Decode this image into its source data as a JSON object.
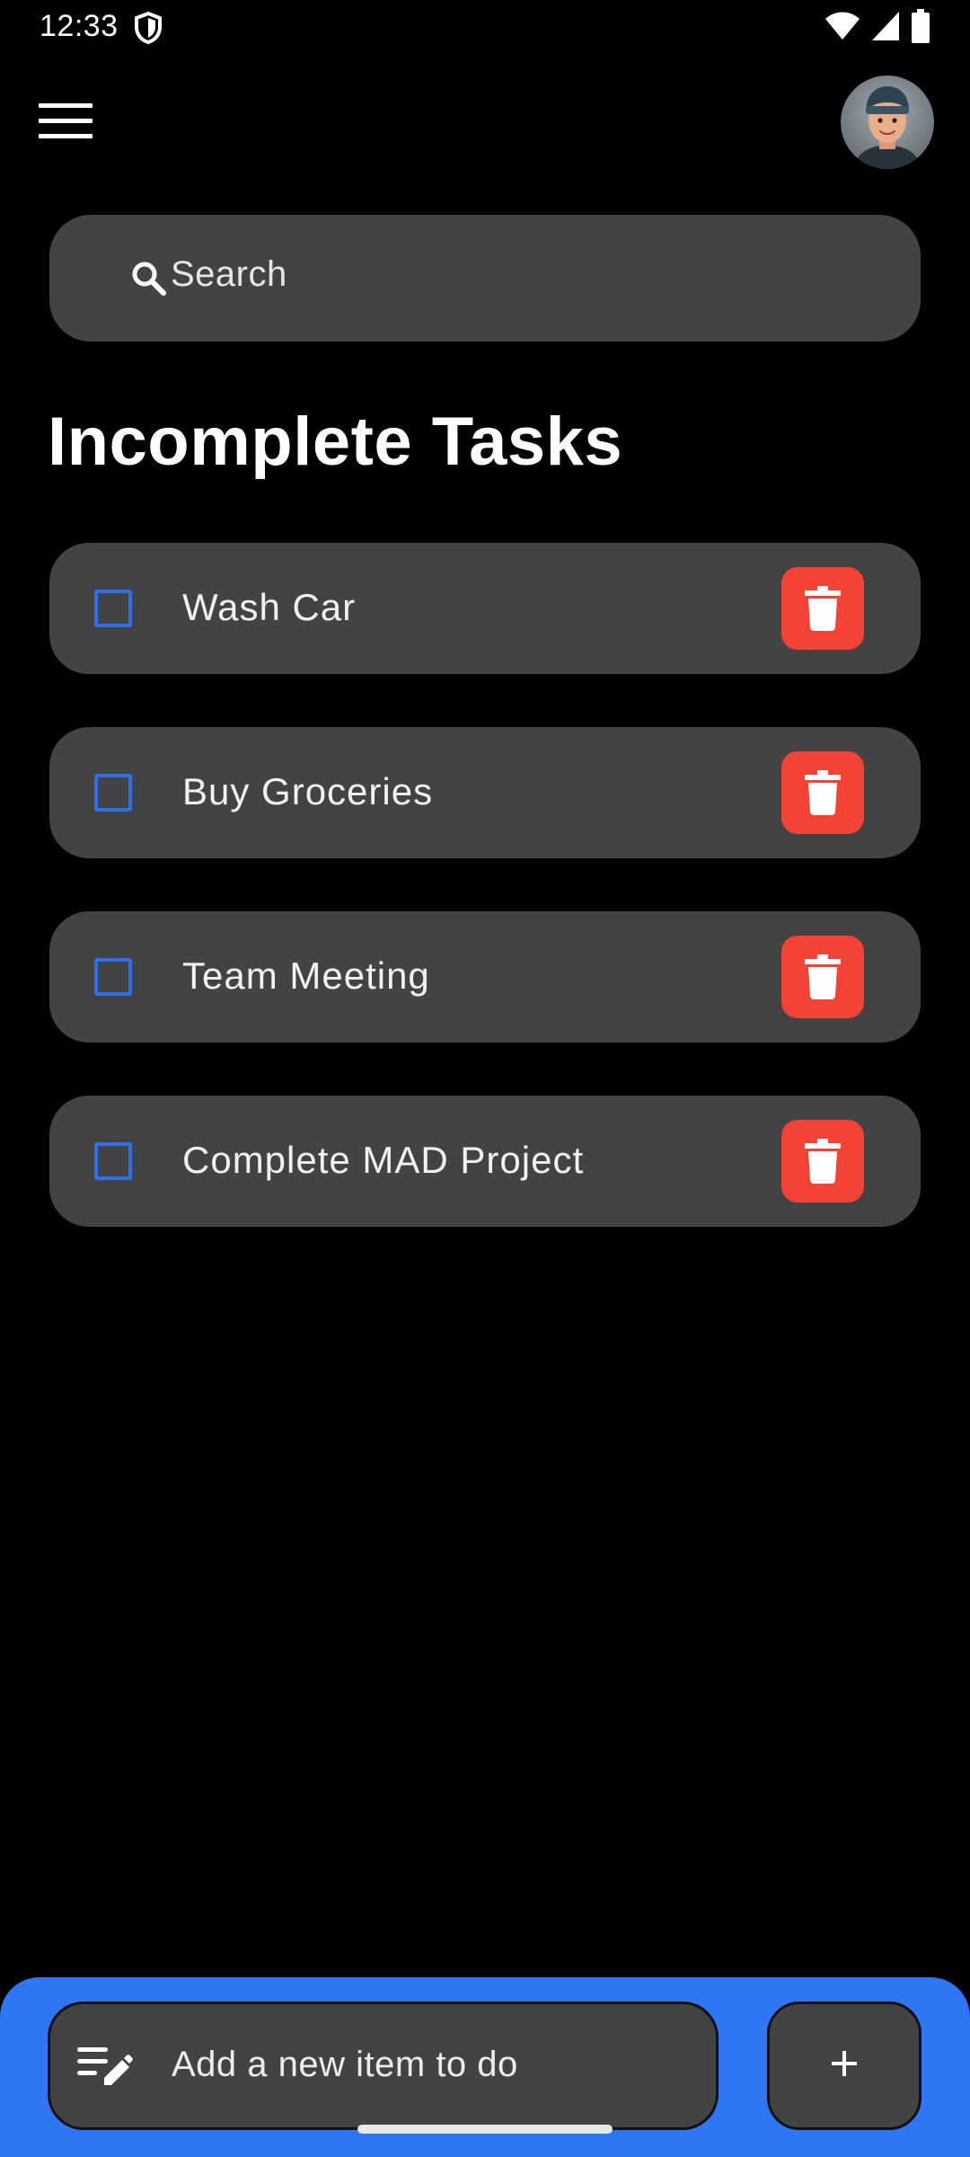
{
  "status_bar": {
    "time": "12:33",
    "icons": [
      "shield-icon",
      "wifi-icon",
      "signal-icon",
      "battery-icon"
    ]
  },
  "app_bar": {
    "menu_icon": "menu-icon",
    "avatar": "user-avatar"
  },
  "search": {
    "placeholder": "Search",
    "icon": "search-icon"
  },
  "section": {
    "title": "Incomplete Tasks"
  },
  "tasks": [
    {
      "label": "Wash Car",
      "checked": false
    },
    {
      "label": "Buy Groceries",
      "checked": false
    },
    {
      "label": "Team Meeting",
      "checked": false
    },
    {
      "label": "Complete MAD Project",
      "checked": false
    }
  ],
  "bottom_bar": {
    "input_placeholder": "Add a new item to do",
    "input_icon": "edit-note-icon",
    "add_button_icon": "plus-icon"
  },
  "colors": {
    "background": "#000000",
    "card": "#434343",
    "accent": "#2f76f5",
    "checkbox_border": "#2f6fed",
    "delete": "#f44336"
  }
}
